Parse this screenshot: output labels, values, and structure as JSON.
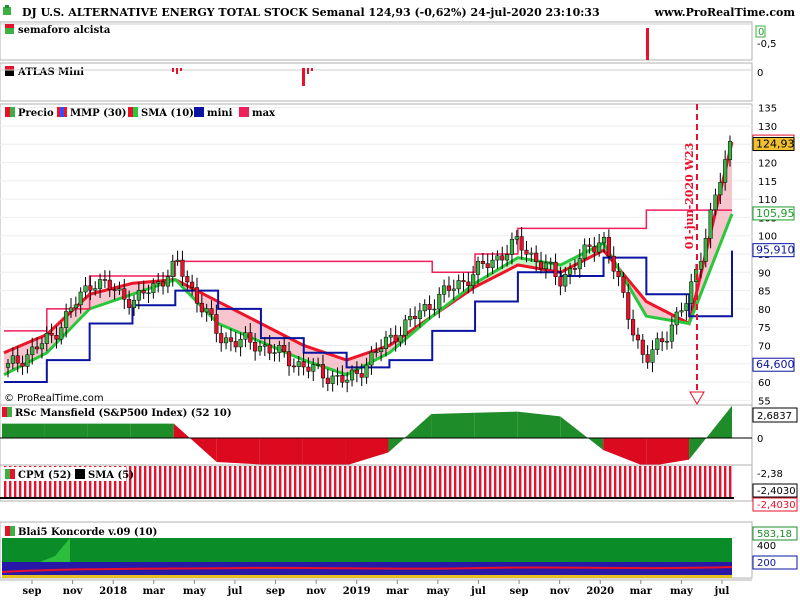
{
  "header": {
    "title": "DJ U.S. ALTERNATIVE ENERGY TOTAL STOCK Semanal 124,93 (-0,62%) 24-jul-2020 23:10:33",
    "site": "www.ProRealTime.com"
  },
  "watermark": "© ProRealTime.com",
  "annotation": {
    "text": "01-jun-2020 W23"
  },
  "colors": {
    "bull_candle": "#3cb043",
    "bear_candle": "#e8102a",
    "mmp_line": "#f01428",
    "sma_line": "#28c83c",
    "mini_line": "#0a14a0",
    "max_line": "#f01e5a",
    "panel_bg": "#eef0fa",
    "positive_fill": "#1e8c28",
    "negative_fill": "#dc0a1e"
  },
  "panels": {
    "semaforo": {
      "label": "semaforo alcista",
      "yticks": [
        "0",
        "-0,5"
      ]
    },
    "atlas": {
      "label": "ATLAS Mini",
      "yticks": [
        "0"
      ]
    },
    "price": {
      "legend": [
        {
          "label": "Precio",
          "color": "#3cb043"
        },
        {
          "label": "MMP (30)",
          "color": "#f01428"
        },
        {
          "label": "SMA (10)",
          "color": "#28c83c"
        },
        {
          "label": "mini",
          "color": "#0a14a0"
        },
        {
          "label": "max",
          "color": "#f01e5a"
        }
      ],
      "yticks": [
        "135",
        "130",
        "125",
        "120",
        "115",
        "110",
        "105",
        "100",
        "95",
        "90",
        "85",
        "80",
        "75",
        "70",
        "65",
        "60",
        "55"
      ],
      "value_tags": [
        {
          "text": "125,59",
          "value": 125.59,
          "bg": "#ffffff",
          "fg": "#e8102a"
        },
        {
          "text": "124,93",
          "value": 124.93,
          "bg": "#f0c030",
          "fg": "#000000"
        },
        {
          "text": "105,95",
          "value": 105.95,
          "bg": "#ffffff",
          "fg": "#1e9c28"
        },
        {
          "text": "95,910",
          "value": 95.91,
          "bg": "#ffffff",
          "fg": "#0a14a0"
        },
        {
          "text": "64,600",
          "value": 64.6,
          "bg": "#ffffff",
          "fg": "#0a14a0"
        }
      ]
    },
    "rsc": {
      "label": "RSc Mansfield (S&P500 Index) (52 10)",
      "yticks": [
        "0"
      ],
      "value_tag": "2,6837"
    },
    "cpm": {
      "legend": [
        {
          "label": "CPM (52)",
          "color": "#e8102a"
        },
        {
          "label": "SMA (5)",
          "color": "#000000"
        }
      ],
      "yticks": [
        "-2,38"
      ],
      "value_tags": [
        "-2,4030",
        "-2,4030"
      ]
    },
    "koncorde": {
      "label": "Blai5 Koncorde v.09 (10)",
      "yticks": [
        "400",
        "200"
      ],
      "value_tag": "583,18"
    }
  },
  "x_axis": {
    "labels": [
      "sep",
      "nov",
      "2018",
      "mar",
      "may",
      "jul",
      "sep",
      "nov",
      "2019",
      "mar",
      "may",
      "jul",
      "sep",
      "nov",
      "2020",
      "mar",
      "may",
      "jul"
    ]
  },
  "chart_data": [
    {
      "type": "line",
      "panel": "price",
      "period": "weekly",
      "x_range": [
        "2017-08",
        "2020-07-24"
      ],
      "ylim": [
        54,
        136
      ],
      "last_close": 124.93,
      "change_pct": -0.62,
      "series": [
        {
          "name": "Precio",
          "x": [
            "sep 2017",
            "nov 2017",
            "2018",
            "mar 2018",
            "may 2018",
            "jul 2018",
            "sep 2018",
            "nov 2018",
            "2019",
            "mar 2019",
            "may 2019",
            "jul 2019",
            "sep 2019",
            "nov 2019",
            "2020",
            "mar 2020",
            "may 2020",
            "jul 2020"
          ],
          "values": [
            64,
            72,
            88,
            82,
            92,
            72,
            70,
            64,
            60,
            72,
            82,
            90,
            98,
            88,
            100,
            65,
            82,
            124.93
          ]
        },
        {
          "name": "MMP (30)",
          "x": [
            "sep 2017",
            "nov 2017",
            "2018",
            "mar 2018",
            "may 2018",
            "jul 2018",
            "sep 2018",
            "nov 2018",
            "2019",
            "mar 2019",
            "may 2019",
            "jul 2019",
            "sep 2019",
            "nov 2019",
            "2020",
            "mar 2020",
            "may 2020",
            "jul 2020"
          ],
          "values": [
            68,
            73,
            84,
            87,
            88,
            82,
            76,
            70,
            66,
            70,
            78,
            86,
            92,
            90,
            96,
            82,
            76,
            125.59
          ]
        },
        {
          "name": "SMA (10)",
          "x": [
            "sep 2017",
            "nov 2017",
            "2018",
            "mar 2018",
            "may 2018",
            "jul 2018",
            "sep 2018",
            "nov 2018",
            "2019",
            "mar 2019",
            "may 2019",
            "jul 2019",
            "sep 2019",
            "nov 2019",
            "2020",
            "mar 2020",
            "may 2020",
            "jul 2020"
          ],
          "values": [
            62,
            68,
            80,
            84,
            88,
            76,
            71,
            66,
            62,
            68,
            78,
            87,
            94,
            92,
            98,
            78,
            76,
            105.95
          ]
        },
        {
          "name": "mini",
          "x": [
            "sep 2017",
            "nov 2017",
            "2018",
            "mar 2018",
            "may 2018",
            "jul 2018",
            "sep 2018",
            "nov 2018",
            "2019",
            "mar 2019",
            "may 2019",
            "jul 2019",
            "sep 2019",
            "nov 2019",
            "2020",
            "mar 2020",
            "may 2020",
            "jul 2020"
          ],
          "values": [
            60,
            66,
            76,
            81,
            85,
            80,
            72,
            68,
            64,
            66,
            74,
            82,
            90,
            89,
            94,
            84,
            78,
            95.91
          ]
        },
        {
          "name": "max",
          "x": [
            "sep 2017",
            "nov 2017",
            "2018",
            "mar 2018",
            "may 2018",
            "jul 2018",
            "sep 2018",
            "nov 2018",
            "2019",
            "mar 2019",
            "may 2019",
            "jul 2019",
            "sep 2019",
            "nov 2019",
            "2020",
            "mar 2020",
            "may 2020",
            "jul 2020"
          ],
          "values": [
            74,
            80,
            89,
            89,
            93,
            93,
            93,
            93,
            93,
            93,
            90,
            95,
            102,
            102,
            102,
            107,
            107,
            107
          ]
        }
      ]
    },
    {
      "type": "area",
      "panel": "rsc",
      "x": [
        "sep 2017",
        "nov 2017",
        "2018",
        "mar 2018",
        "may 2018",
        "jul 2018",
        "sep 2018",
        "nov 2018",
        "2019",
        "mar 2019",
        "may 2019",
        "jul 2019",
        "sep 2019",
        "nov 2019",
        "2020",
        "mar 2020",
        "may 2020",
        "jul 2020"
      ],
      "series": [
        {
          "name": "RSc Mansfield (S&P500 Index) (52 10)",
          "values": [
            1.2,
            1.2,
            1.2,
            1.2,
            1.2,
            -2.0,
            -2.2,
            -2.4,
            -2.3,
            -1.2,
            2.0,
            2.1,
            2.2,
            1.8,
            -1.0,
            -2.4,
            -1.8,
            2.6837
          ]
        }
      ]
    },
    {
      "type": "bar",
      "panel": "cpm",
      "series": [
        {
          "name": "CPM (52)",
          "values": [
            -2.403
          ]
        },
        {
          "name": "SMA (5)",
          "values": [
            -2.403
          ]
        }
      ]
    },
    {
      "type": "area",
      "panel": "koncorde",
      "series": [
        {
          "name": "Blai5 Koncorde v.09 (10)",
          "values": [
            100,
            200,
            583.18
          ]
        }
      ]
    }
  ]
}
